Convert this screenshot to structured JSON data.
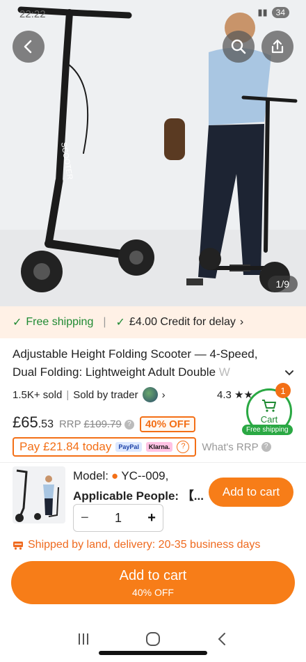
{
  "status": {
    "time": "22:22",
    "battery": "34"
  },
  "hero": {
    "image_counter": "1/9",
    "scooter_label": "SCOOTER"
  },
  "shipping": {
    "free": "Free shipping",
    "credit": "£4.00 Credit for delay"
  },
  "product": {
    "title_main": "Adjustable Height Folding Scooter — 4-Speed, Dual Folding: Lightweight Adult Double ",
    "title_fade": "W",
    "sold": "1.5K+ sold",
    "sold_by": "Sold by trader",
    "rating": "4.3"
  },
  "cart_float": {
    "count": "1",
    "label": "Cart",
    "free": "Free shipping"
  },
  "price": {
    "current_whole": "£65",
    "current_cents": ".53",
    "rrp_label": "RRP",
    "rrp_value": "£109.79",
    "discount": "40% OFF"
  },
  "pay": {
    "today": "Pay £21.84 today",
    "paypal": "PayPal",
    "klarna": "Klarna.",
    "whats_rrp": "What's RRP"
  },
  "sku": {
    "model": "Model:",
    "model_value": "YC--009,",
    "people": "Applicable People: 【...",
    "add_button": "Add to cart",
    "qty": "1",
    "minus": "−",
    "plus": "+"
  },
  "delivery": "Shipped by land, delivery: 20-35 business days",
  "cta": {
    "label": "Add to cart",
    "sub": "40% OFF"
  },
  "colors": {
    "accent": "#f77d18",
    "green": "#1f8a33"
  }
}
